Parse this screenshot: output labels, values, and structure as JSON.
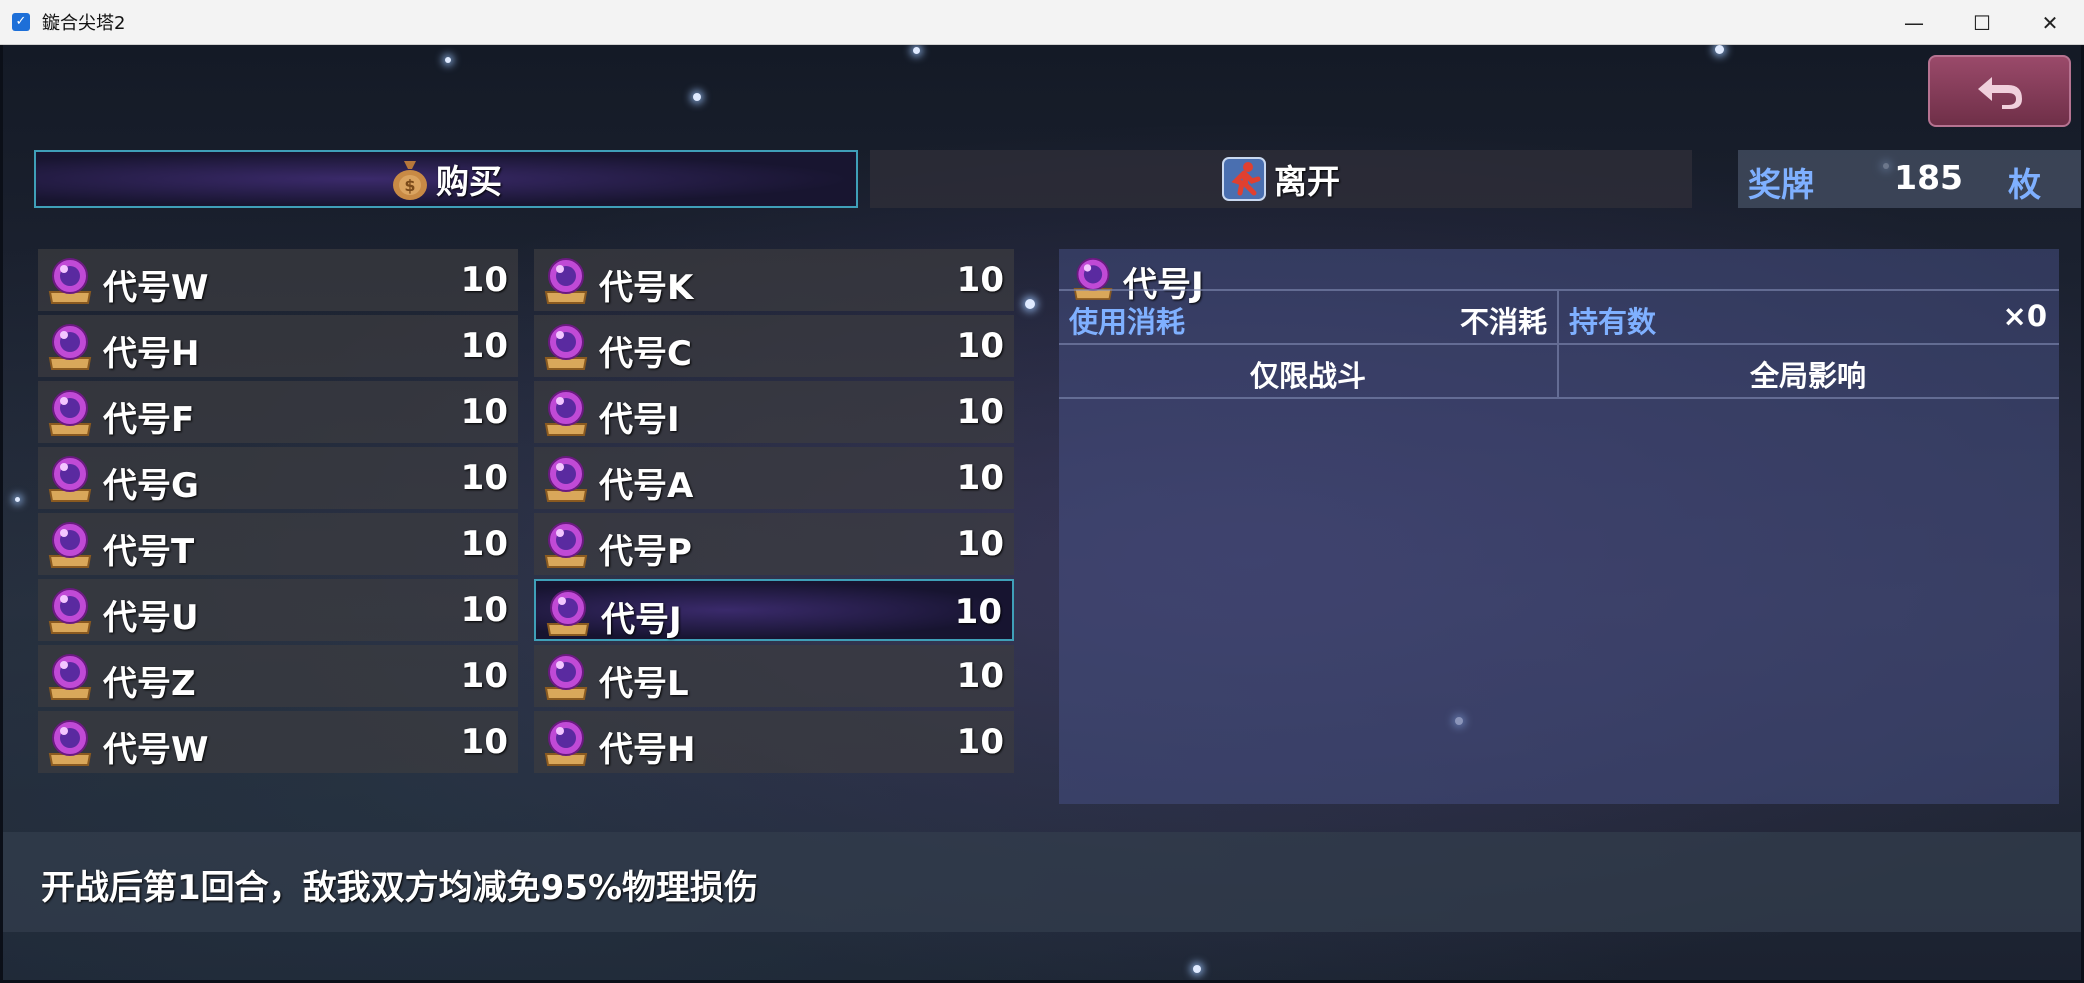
{
  "window": {
    "title": "鏇合尖塔2",
    "minimize": "—",
    "maximize": "☐",
    "close": "✕"
  },
  "tabs": {
    "buy": "购买",
    "leave": "离开"
  },
  "medal": {
    "label": "奖牌",
    "value": "185",
    "unit": "枚"
  },
  "items": [
    {
      "name": "代号W",
      "price": "10"
    },
    {
      "name": "代号K",
      "price": "10"
    },
    {
      "name": "代号H",
      "price": "10"
    },
    {
      "name": "代号C",
      "price": "10"
    },
    {
      "name": "代号F",
      "price": "10"
    },
    {
      "name": "代号I",
      "price": "10"
    },
    {
      "name": "代号G",
      "price": "10"
    },
    {
      "name": "代号A",
      "price": "10"
    },
    {
      "name": "代号T",
      "price": "10"
    },
    {
      "name": "代号P",
      "price": "10"
    },
    {
      "name": "代号U",
      "price": "10"
    },
    {
      "name": "代号J",
      "price": "10"
    },
    {
      "name": "代号Z",
      "price": "10"
    },
    {
      "name": "代号L",
      "price": "10"
    },
    {
      "name": "代号W",
      "price": "10"
    },
    {
      "name": "代号H",
      "price": "10"
    }
  ],
  "selected_index": 11,
  "detail": {
    "name": "代号J",
    "use_cost_label": "使用消耗",
    "use_cost_value": "不消耗",
    "owned_label": "持有数",
    "owned_value": "×0",
    "scope": "仅限战斗",
    "effect_range": "全局影响"
  },
  "description": "开战后第1回合，敌我双方均减免95%物理损伤",
  "colors": {
    "accent_border": "#3f9fb8",
    "label_blue": "#7fb0ff",
    "back_button": "#8a3f5f"
  },
  "icons": {
    "item": "crystal-ball-icon",
    "buy": "money-bag-icon",
    "leave": "running-man-icon",
    "back": "return-arrow-icon"
  }
}
